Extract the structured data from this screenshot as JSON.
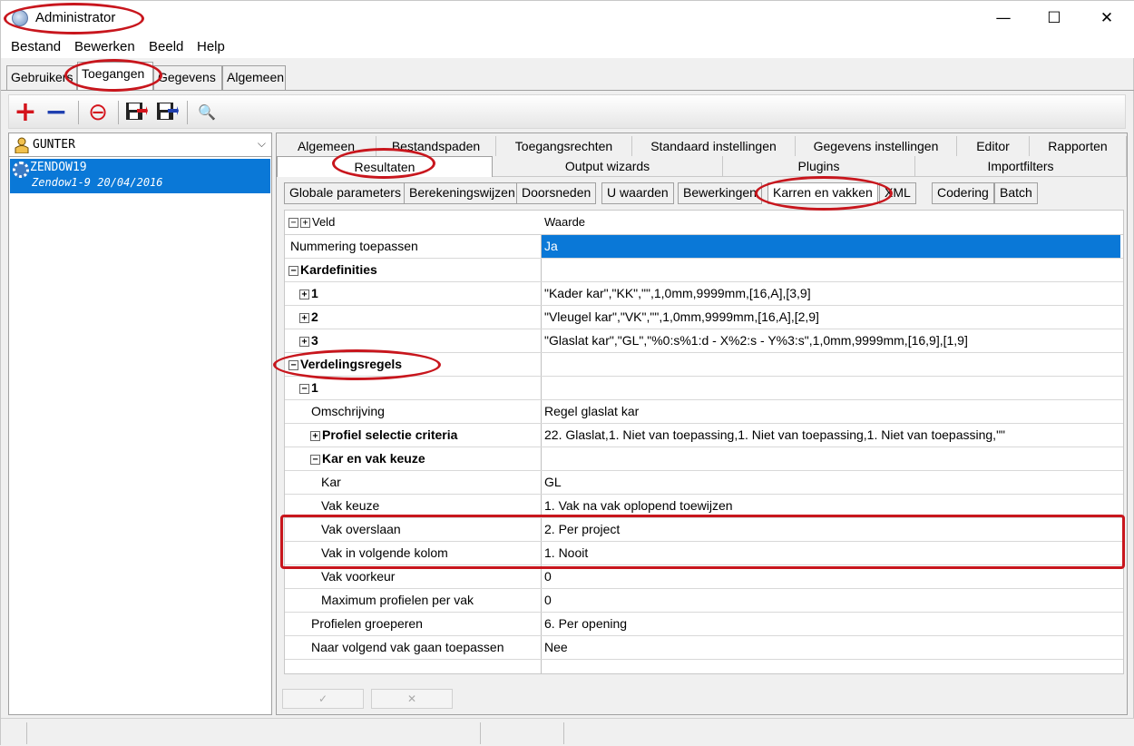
{
  "window": {
    "title": "Administrator",
    "minimize": "—",
    "maximize": "☐",
    "close": "✕"
  },
  "menu": [
    "Bestand",
    "Bewerken",
    "Beeld",
    "Help"
  ],
  "top_tabs": [
    "Gebruikers",
    "Toegangen",
    "Gegevens",
    "Algemeen"
  ],
  "toolbar": {
    "add": "+",
    "remove": "−",
    "stop": "⊖",
    "search": "🔍"
  },
  "left": {
    "user": "GUNTER",
    "selected_item_line1": "ZENDOW19",
    "selected_item_line2": "Zendow1-9 20/04/2016"
  },
  "tabs_row1": [
    "Algemeen",
    "Bestandspaden",
    "Toegangsrechten",
    "Standaard instellingen",
    "Gegevens instellingen",
    "Editor",
    "Rapporten"
  ],
  "tabs_row2": [
    "Resultaten",
    "Output wizards",
    "Plugins",
    "Importfilters"
  ],
  "subtabs": [
    "Globale parameters",
    "Berekeningswijzen",
    "Doorsneden",
    "U waarden",
    "Bewerkingen",
    "Karren en vakken",
    "XML",
    "Codering",
    "Batch"
  ],
  "grid": {
    "col_field": "Veld",
    "col_value": "Waarde",
    "rows": [
      {
        "key": "Nummering toepassen",
        "value": "Ja"
      },
      {
        "key": "Kardefinities",
        "value": ""
      },
      {
        "key": "1",
        "value": "\"Kader kar\",\"KK\",\"\",1,0mm,9999mm,[16,A],[3,9]"
      },
      {
        "key": "2",
        "value": "\"Vleugel kar\",\"VK\",\"\",1,0mm,9999mm,[16,A],[2,9]"
      },
      {
        "key": "3",
        "value": "\"Glaslat kar\",\"GL\",\"%0:s%1:d - X%2:s - Y%3:s\",1,0mm,9999mm,[16,9],[1,9]"
      },
      {
        "key": "Verdelingsregels",
        "value": ""
      },
      {
        "key": "1",
        "value": ""
      },
      {
        "key": "Omschrijving",
        "value": "Regel glaslat kar"
      },
      {
        "key": "Profiel selectie criteria",
        "value": "22. Glaslat,1. Niet van toepassing,1. Niet van toepassing,1. Niet van toepassing,\"\""
      },
      {
        "key": "Kar en vak keuze",
        "value": ""
      },
      {
        "key": "Kar",
        "value": "GL"
      },
      {
        "key": "Vak keuze",
        "value": "1. Vak na vak oplopend toewijzen"
      },
      {
        "key": "Vak overslaan",
        "value": "2. Per project"
      },
      {
        "key": "Vak in volgende kolom",
        "value": "1. Nooit"
      },
      {
        "key": "Vak voorkeur",
        "value": "0"
      },
      {
        "key": "Maximum profielen per vak",
        "value": "0"
      },
      {
        "key": "Profielen groeperen",
        "value": "6. Per opening"
      },
      {
        "key": "Naar volgend vak gaan toepassen",
        "value": "Nee"
      }
    ]
  },
  "bottom_buttons": {
    "ok": "✓",
    "cancel": "✕"
  },
  "colors": {
    "selection": "#0a78d7",
    "annotation": "#c8161d",
    "add_icon": "#d4141c",
    "remove_icon": "#1f3fb0"
  }
}
